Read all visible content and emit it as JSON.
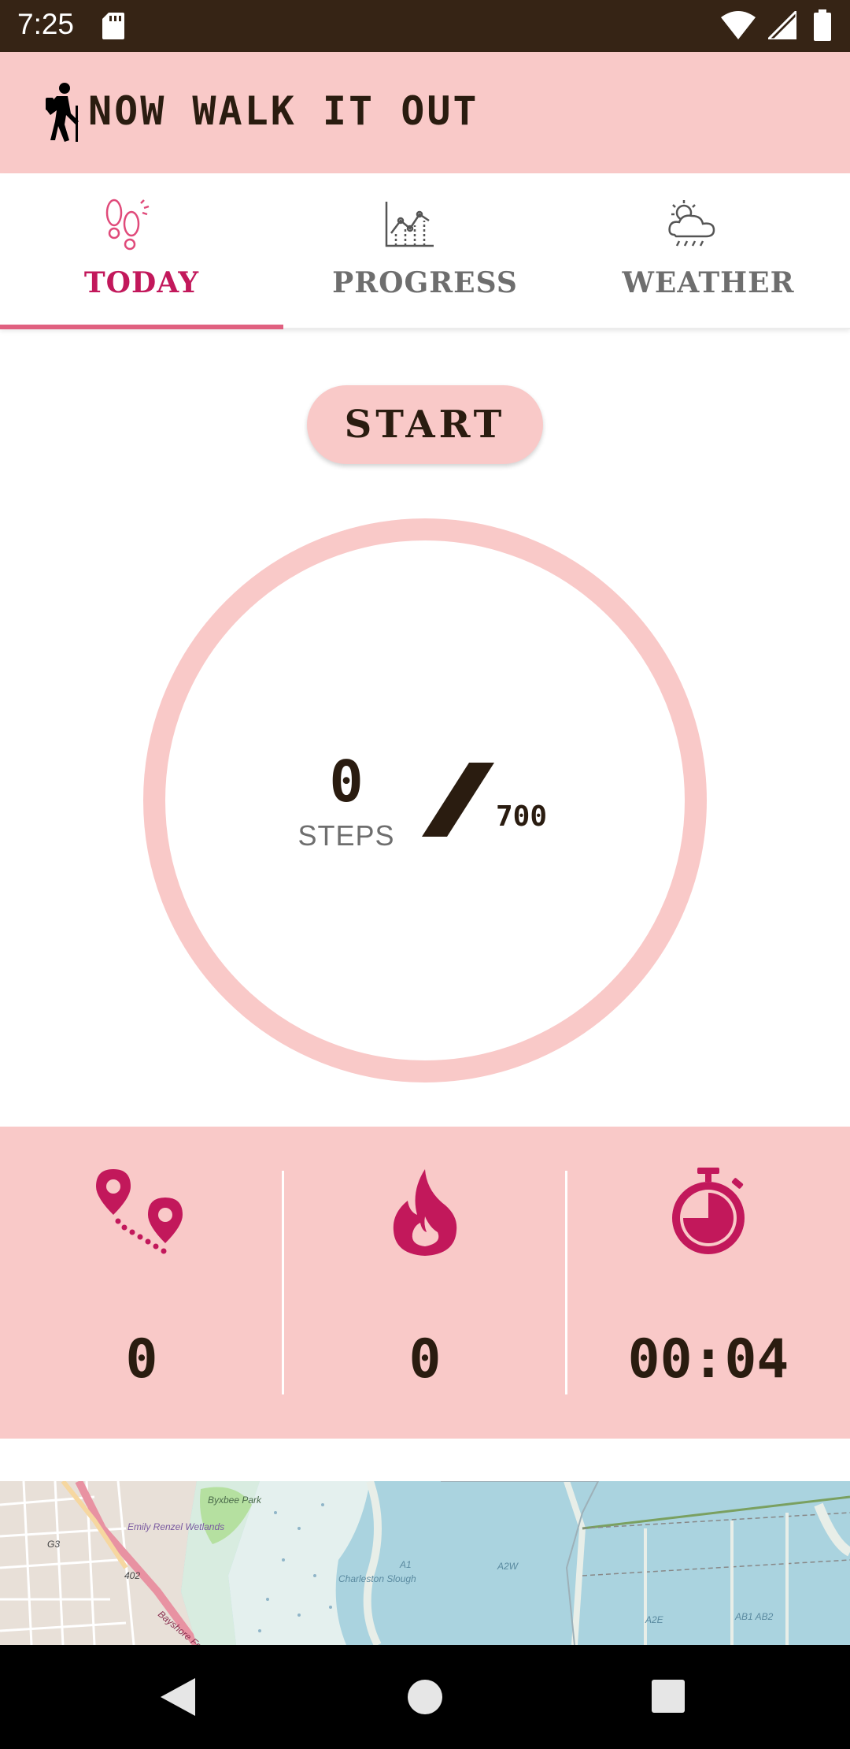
{
  "status_bar": {
    "time": "7:25"
  },
  "app_bar": {
    "title": "NOW WALK IT OUT"
  },
  "tabs": [
    {
      "label": "TODAY",
      "icon": "footprints-icon",
      "active": true
    },
    {
      "label": "PROGRESS",
      "icon": "line-chart-icon",
      "active": false
    },
    {
      "label": "WEATHER",
      "icon": "sun-cloud-rain-icon",
      "active": false
    }
  ],
  "start_button": {
    "label": "START"
  },
  "step_counter": {
    "steps": "0",
    "steps_label": "STEPS",
    "goal": "700",
    "progress_fraction": 0
  },
  "stats": [
    {
      "icon": "route-icon",
      "value": "0"
    },
    {
      "icon": "flame-icon",
      "value": "0"
    },
    {
      "icon": "stopwatch-icon",
      "value": "00:04"
    }
  ],
  "map": {
    "labels": [
      "Byxbee Park",
      "Emily Renzel Wetlands",
      "Charleston Slough",
      "A1",
      "A2W",
      "A2E",
      "AB1 AB2",
      "G3",
      "402",
      "Bayshore Freeway"
    ]
  },
  "colors": {
    "accent_pink": "#f9c9c8",
    "active_tab": "#c2185b",
    "dark_text": "#2a1c10",
    "status_bar": "#362415"
  }
}
